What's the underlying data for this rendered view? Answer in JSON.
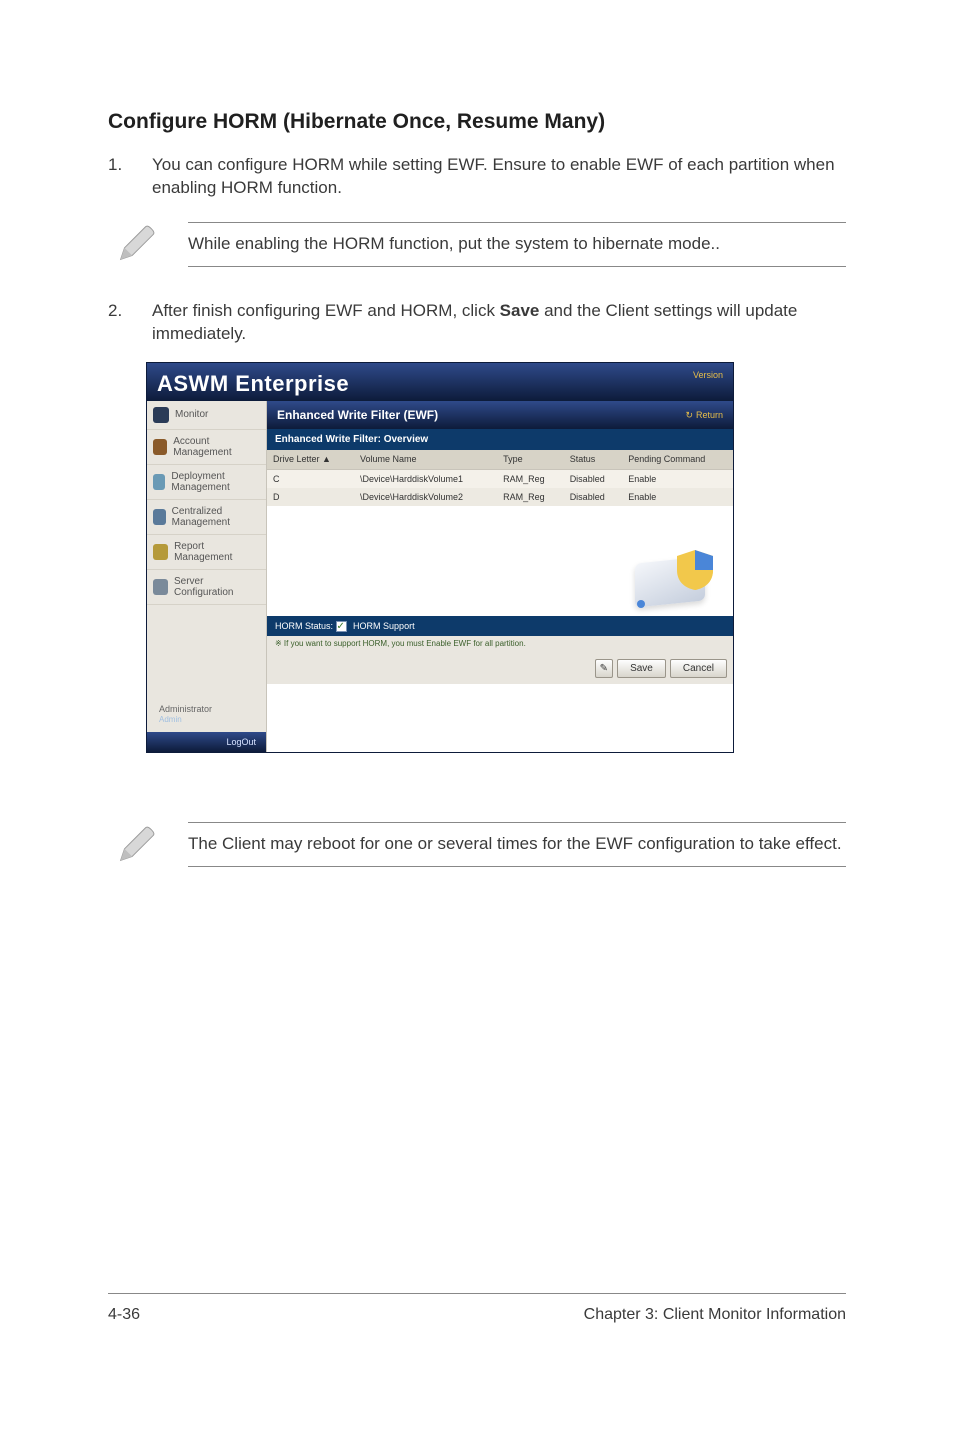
{
  "section_title": "Configure HORM (Hibernate Once, Resume Many)",
  "steps": [
    {
      "num": "1.",
      "text_plain": "You can configure HORM while setting EWF. Ensure to enable EWF of each partition when enabling HORM function."
    },
    {
      "num": "2.",
      "text_before": "After finish configuring EWF and HORM, click ",
      "text_bold": "Save",
      "text_after": " and the Client settings will update immediately."
    }
  ],
  "notes": [
    "While enabling the HORM function, put the system to hibernate mode..",
    "The Client may reboot for one or several times for the EWF configuration to take effect."
  ],
  "app": {
    "title": "ASWM Enterprise",
    "version_label": "Version",
    "sidebar": {
      "items": [
        {
          "label": "Monitor",
          "icon_color": "#2a3b57"
        },
        {
          "label": "Account Management",
          "icon_color": "#8a5a2a"
        },
        {
          "label": "Deployment Management",
          "icon_color": "#6a9ab5"
        },
        {
          "label": "Centralized Management",
          "icon_color": "#5a7a9a"
        },
        {
          "label": "Report Management",
          "icon_color": "#b59a3a"
        },
        {
          "label": "Server Configuration",
          "icon_color": "#7a8a9a"
        }
      ],
      "admin_label": "Administrator",
      "admin_sub": "Admin",
      "logout": "LogOut"
    },
    "panel": {
      "title": "Enhanced Write Filter (EWF)",
      "return_label": "Return",
      "overview_title": "Enhanced Write Filter: Overview",
      "columns": [
        "Drive Letter ▲",
        "Volume Name",
        "Type",
        "Status",
        "Pending Command"
      ],
      "rows": [
        {
          "drive": "C",
          "volume": "\\Device\\HarddiskVolume1",
          "type": "RAM_Reg",
          "status": "Disabled",
          "pending": "Enable"
        },
        {
          "drive": "D",
          "volume": "\\Device\\HarddiskVolume2",
          "type": "RAM_Reg",
          "status": "Disabled",
          "pending": "Enable"
        }
      ],
      "horm_status_label": "HORM Status:",
      "horm_support_label": "HORM Support",
      "horm_note": "※ If you want to support HORM, you must Enable EWF for all partition.",
      "save_label": "Save",
      "cancel_label": "Cancel"
    }
  },
  "footer": {
    "left": "4-36",
    "right": "Chapter 3: Client Monitor Information"
  }
}
